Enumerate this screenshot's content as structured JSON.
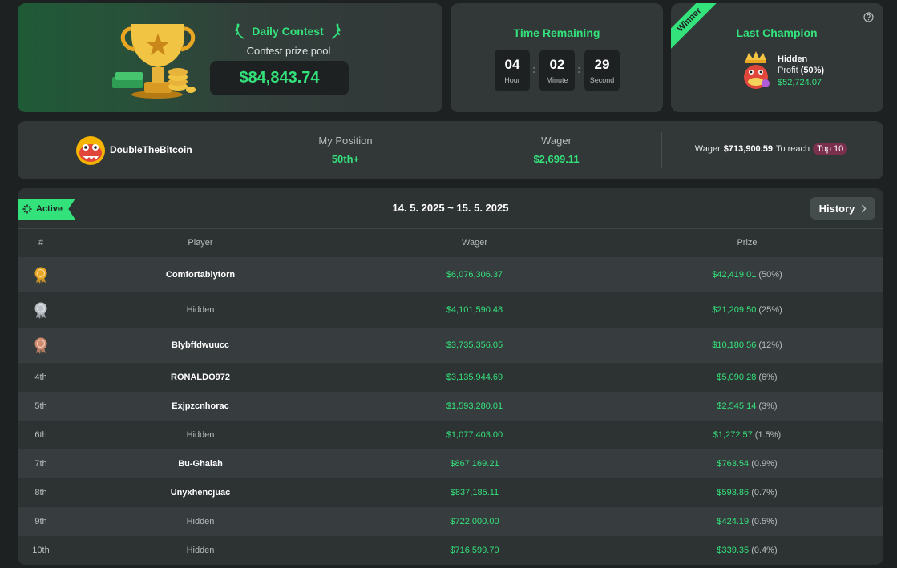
{
  "contest": {
    "title": "Daily Contest",
    "prize_label": "Contest prize pool",
    "prize_amount": "$84,843.74"
  },
  "timer": {
    "title": "Time Remaining",
    "hour": "04",
    "hour_label": "Hour",
    "minute": "02",
    "minute_label": "Minute",
    "second": "29",
    "second_label": "Second"
  },
  "champion": {
    "ribbon": "Winner",
    "title": "Last Champion",
    "name": "Hidden",
    "profit_label": "Profit",
    "profit_pct": "(50%)",
    "amount": "$52,724.07"
  },
  "me": {
    "username": "DoubleTheBitcoin",
    "position_label": "My Position",
    "position_value": "50th+",
    "wager_label": "Wager",
    "wager_value": "$2,699.11",
    "reach_prefix": "Wager",
    "reach_amount": "$713,900.59",
    "reach_text": "To reach",
    "reach_badge": "Top 10"
  },
  "table": {
    "status": "Active",
    "date_range": "14. 5. 2025 ~ 15. 5. 2025",
    "history_label": "History",
    "columns": {
      "rank": "#",
      "player": "Player",
      "wager": "Wager",
      "prize": "Prize"
    },
    "rows": [
      {
        "rank": "",
        "medal": "gold",
        "player": "Comfortablytorn",
        "hidden": false,
        "wager": "$6,076,306.37",
        "prize": "$42,419.01",
        "pct": "(50%)"
      },
      {
        "rank": "",
        "medal": "silver",
        "player": "Hidden",
        "hidden": true,
        "wager": "$4,101,590.48",
        "prize": "$21,209.50",
        "pct": "(25%)"
      },
      {
        "rank": "",
        "medal": "bronze",
        "player": "Blybffdwuucc",
        "hidden": false,
        "wager": "$3,735,356.05",
        "prize": "$10,180.56",
        "pct": "(12%)"
      },
      {
        "rank": "4th",
        "medal": "",
        "player": "RONALDO972",
        "hidden": false,
        "wager": "$3,135,944.69",
        "prize": "$5,090.28",
        "pct": "(6%)"
      },
      {
        "rank": "5th",
        "medal": "",
        "player": "Exjpzcnhorac",
        "hidden": false,
        "wager": "$1,593,280.01",
        "prize": "$2,545.14",
        "pct": "(3%)"
      },
      {
        "rank": "6th",
        "medal": "",
        "player": "Hidden",
        "hidden": true,
        "wager": "$1,077,403.00",
        "prize": "$1,272.57",
        "pct": "(1.5%)"
      },
      {
        "rank": "7th",
        "medal": "",
        "player": "Bu-Ghalah",
        "hidden": false,
        "wager": "$867,169.21",
        "prize": "$763.54",
        "pct": "(0.9%)"
      },
      {
        "rank": "8th",
        "medal": "",
        "player": "Unyxhencjuac",
        "hidden": false,
        "wager": "$837,185.11",
        "prize": "$593.86",
        "pct": "(0.7%)"
      },
      {
        "rank": "9th",
        "medal": "",
        "player": "Hidden",
        "hidden": true,
        "wager": "$722,000.00",
        "prize": "$424.19",
        "pct": "(0.5%)"
      },
      {
        "rank": "10th",
        "medal": "",
        "player": "Hidden",
        "hidden": true,
        "wager": "$716,599.70",
        "prize": "$339.35",
        "pct": "(0.4%)"
      }
    ]
  },
  "colors": {
    "accent": "#34e27c",
    "background": "#1e2121",
    "card": "#323738",
    "gold": "#e8a623",
    "silver": "#b9bfc4",
    "bronze": "#d08a6e",
    "badge": "#7a2f4c"
  },
  "icons": {
    "trophy": "trophy-icon",
    "laurel": "laurel-icon",
    "help": "help-circle-icon",
    "spinner": "spinner-icon",
    "chevron": "chevron-right-icon",
    "medal": "medal-icon"
  }
}
